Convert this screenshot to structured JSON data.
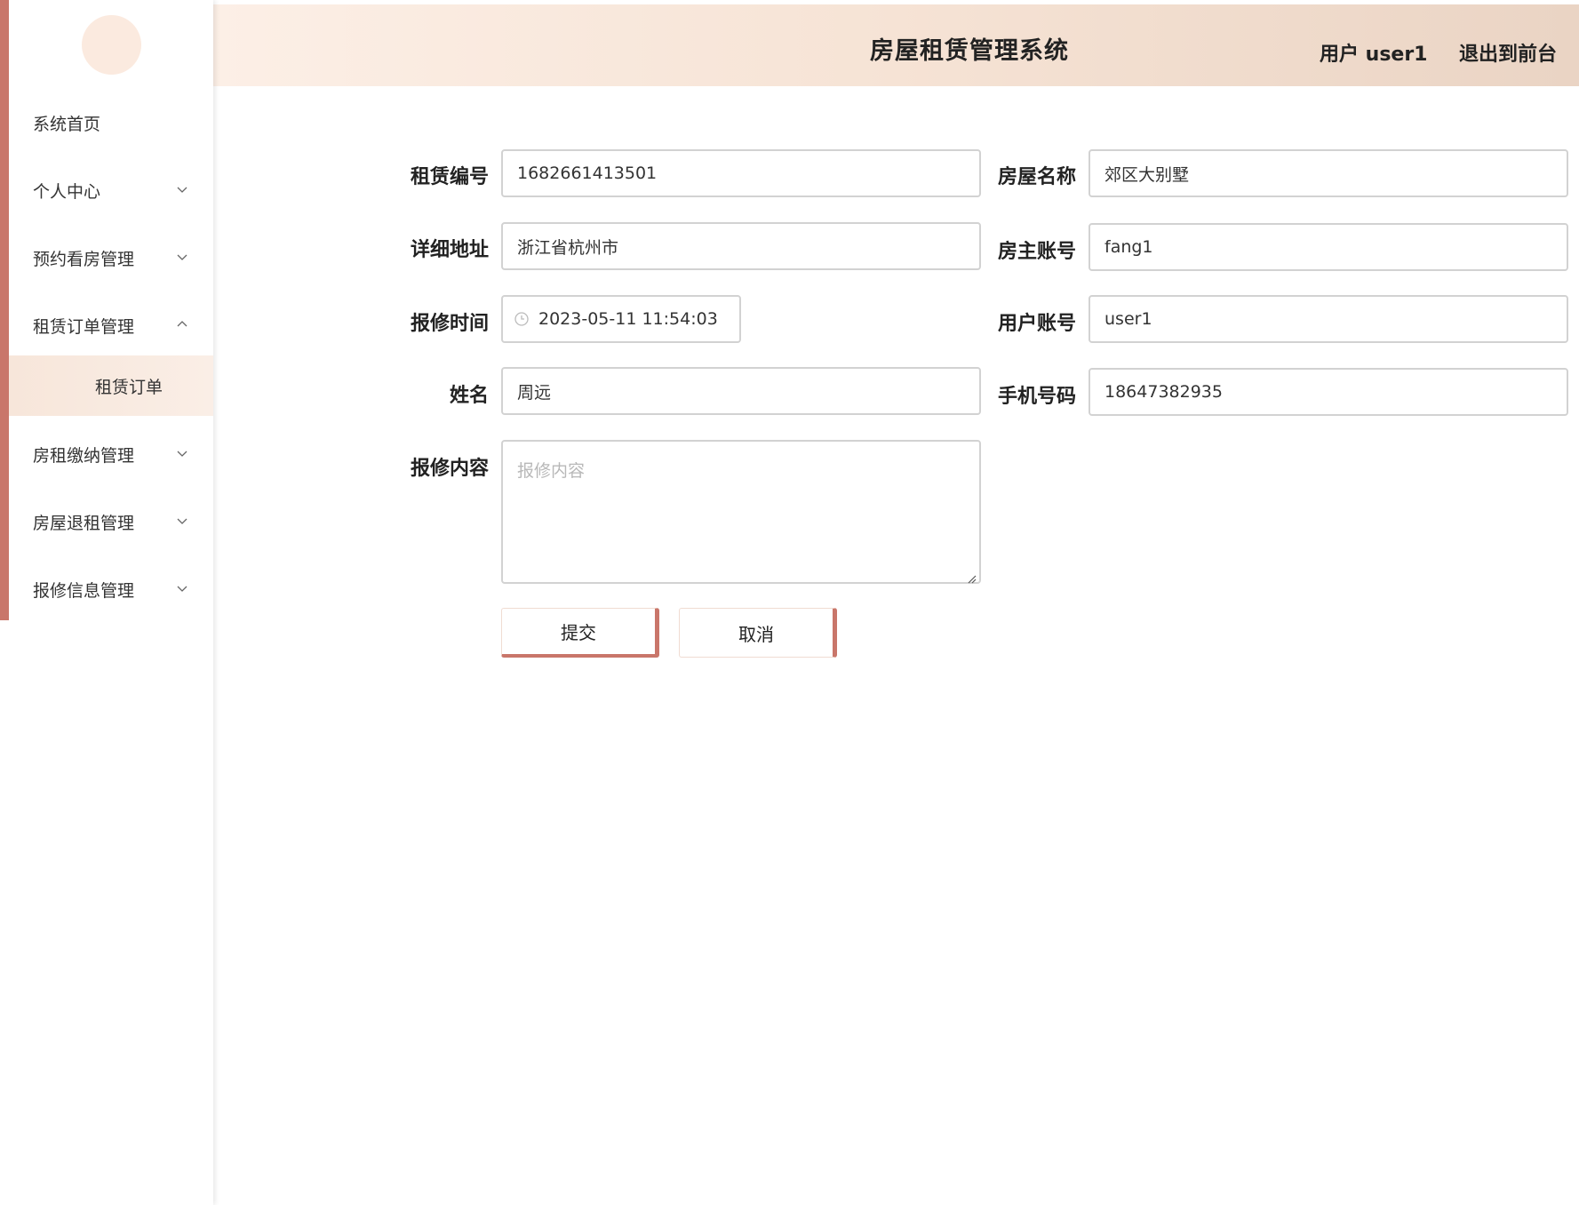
{
  "header": {
    "title": "房屋租赁管理系统",
    "user": "用户 user1",
    "logout": "退出到前台"
  },
  "sidebar": {
    "items": [
      {
        "label": "系统首页"
      },
      {
        "label": "个人中心"
      },
      {
        "label": "预约看房管理"
      },
      {
        "label": "租赁订单管理"
      },
      {
        "label": "房租缴纳管理"
      },
      {
        "label": "房屋退租管理"
      },
      {
        "label": "报修信息管理"
      }
    ],
    "submenu": {
      "label": "租赁订单"
    }
  },
  "form": {
    "lease_no": {
      "label": "租赁编号",
      "value": "1682661413501"
    },
    "house_name": {
      "label": "房屋名称",
      "value": "郊区大别墅"
    },
    "address": {
      "label": "详细地址",
      "value": "浙江省杭州市"
    },
    "owner_account": {
      "label": "房主账号",
      "value": "fang1"
    },
    "repair_time": {
      "label": "报修时间",
      "value": "2023-05-11 11:54:03"
    },
    "user_account": {
      "label": "用户账号",
      "value": "user1"
    },
    "name": {
      "label": "姓名",
      "value": "周远"
    },
    "phone": {
      "label": "手机号码",
      "value": "18647382935"
    },
    "content": {
      "label": "报修内容",
      "placeholder": "报修内容"
    }
  },
  "buttons": {
    "submit": "提交",
    "cancel": "取消"
  },
  "colors": {
    "accent": "#c9766a",
    "header_gradient_start": "#fcefe6",
    "header_gradient_end": "#ead4c4",
    "submenu_bg": "#f7e6da",
    "avatar_bg": "#fbeadf"
  }
}
